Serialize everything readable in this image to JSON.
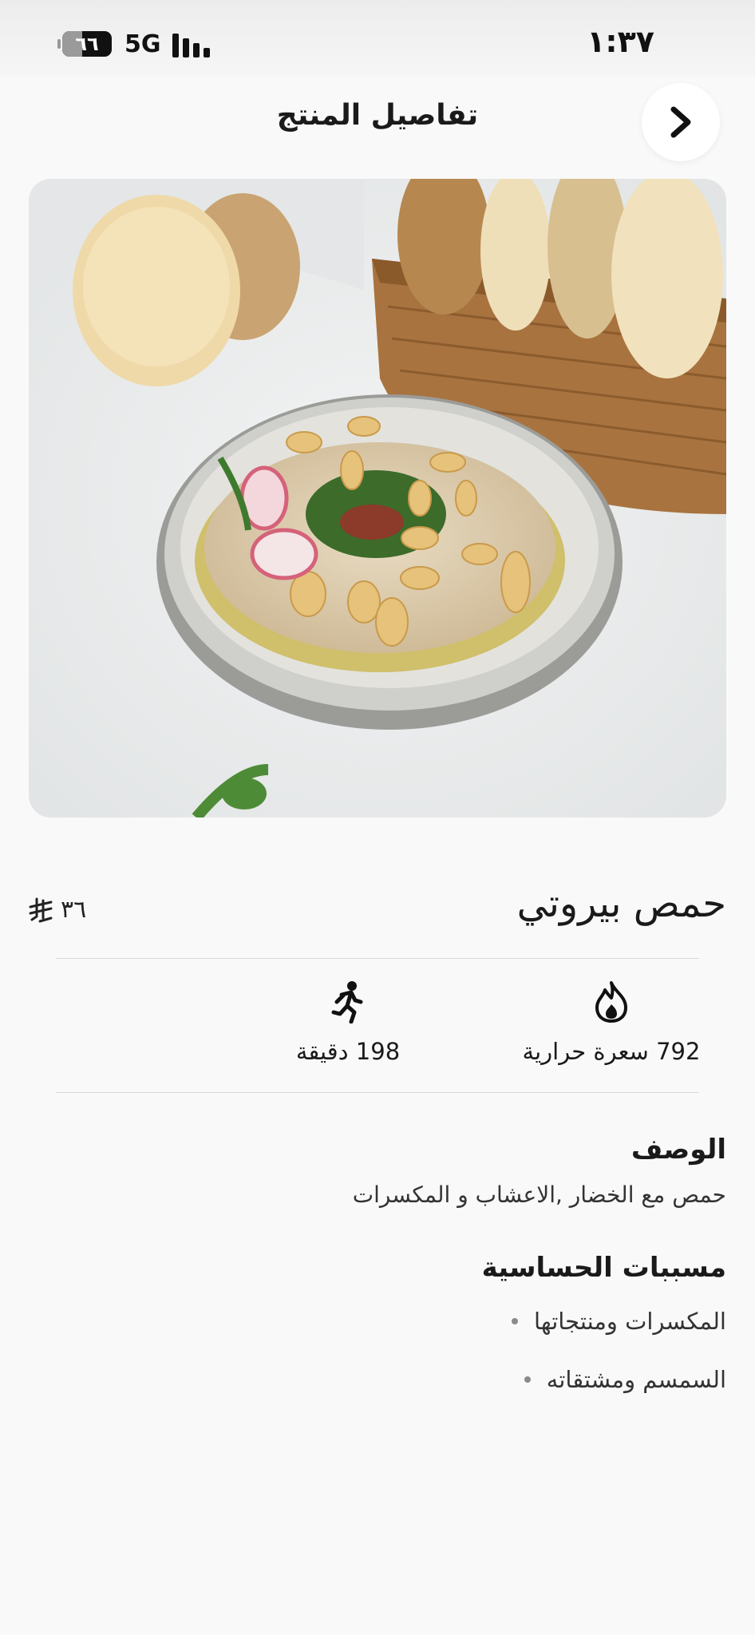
{
  "status_bar": {
    "battery": "٦٦",
    "network": "5G",
    "time": "١:٣٧"
  },
  "header": {
    "title": "تفاصيل المنتج",
    "back_icon": "chevron-right-icon"
  },
  "product": {
    "image_alt": "حمص بيروتي",
    "name": "حمص بيروتي",
    "price": "٣٦",
    "currency_icon": "riyal-currency-icon"
  },
  "stats": {
    "calories": {
      "icon": "fire-icon",
      "label": "792 سعرة حرارية"
    },
    "activity": {
      "icon": "running-person-icon",
      "label": "198 دقيقة"
    }
  },
  "description": {
    "title": "الوصف",
    "text": "حمص مع الخضار ,الاعشاب و المكسرات"
  },
  "allergens": {
    "title": "مسببات الحساسية",
    "items": [
      "المكسرات ومنتجاتها",
      "السمسم ومشتقاته"
    ]
  },
  "colors": {
    "background": "#f9f9f9",
    "text": "#1b1b1b",
    "divider": "#d9d9d9"
  }
}
